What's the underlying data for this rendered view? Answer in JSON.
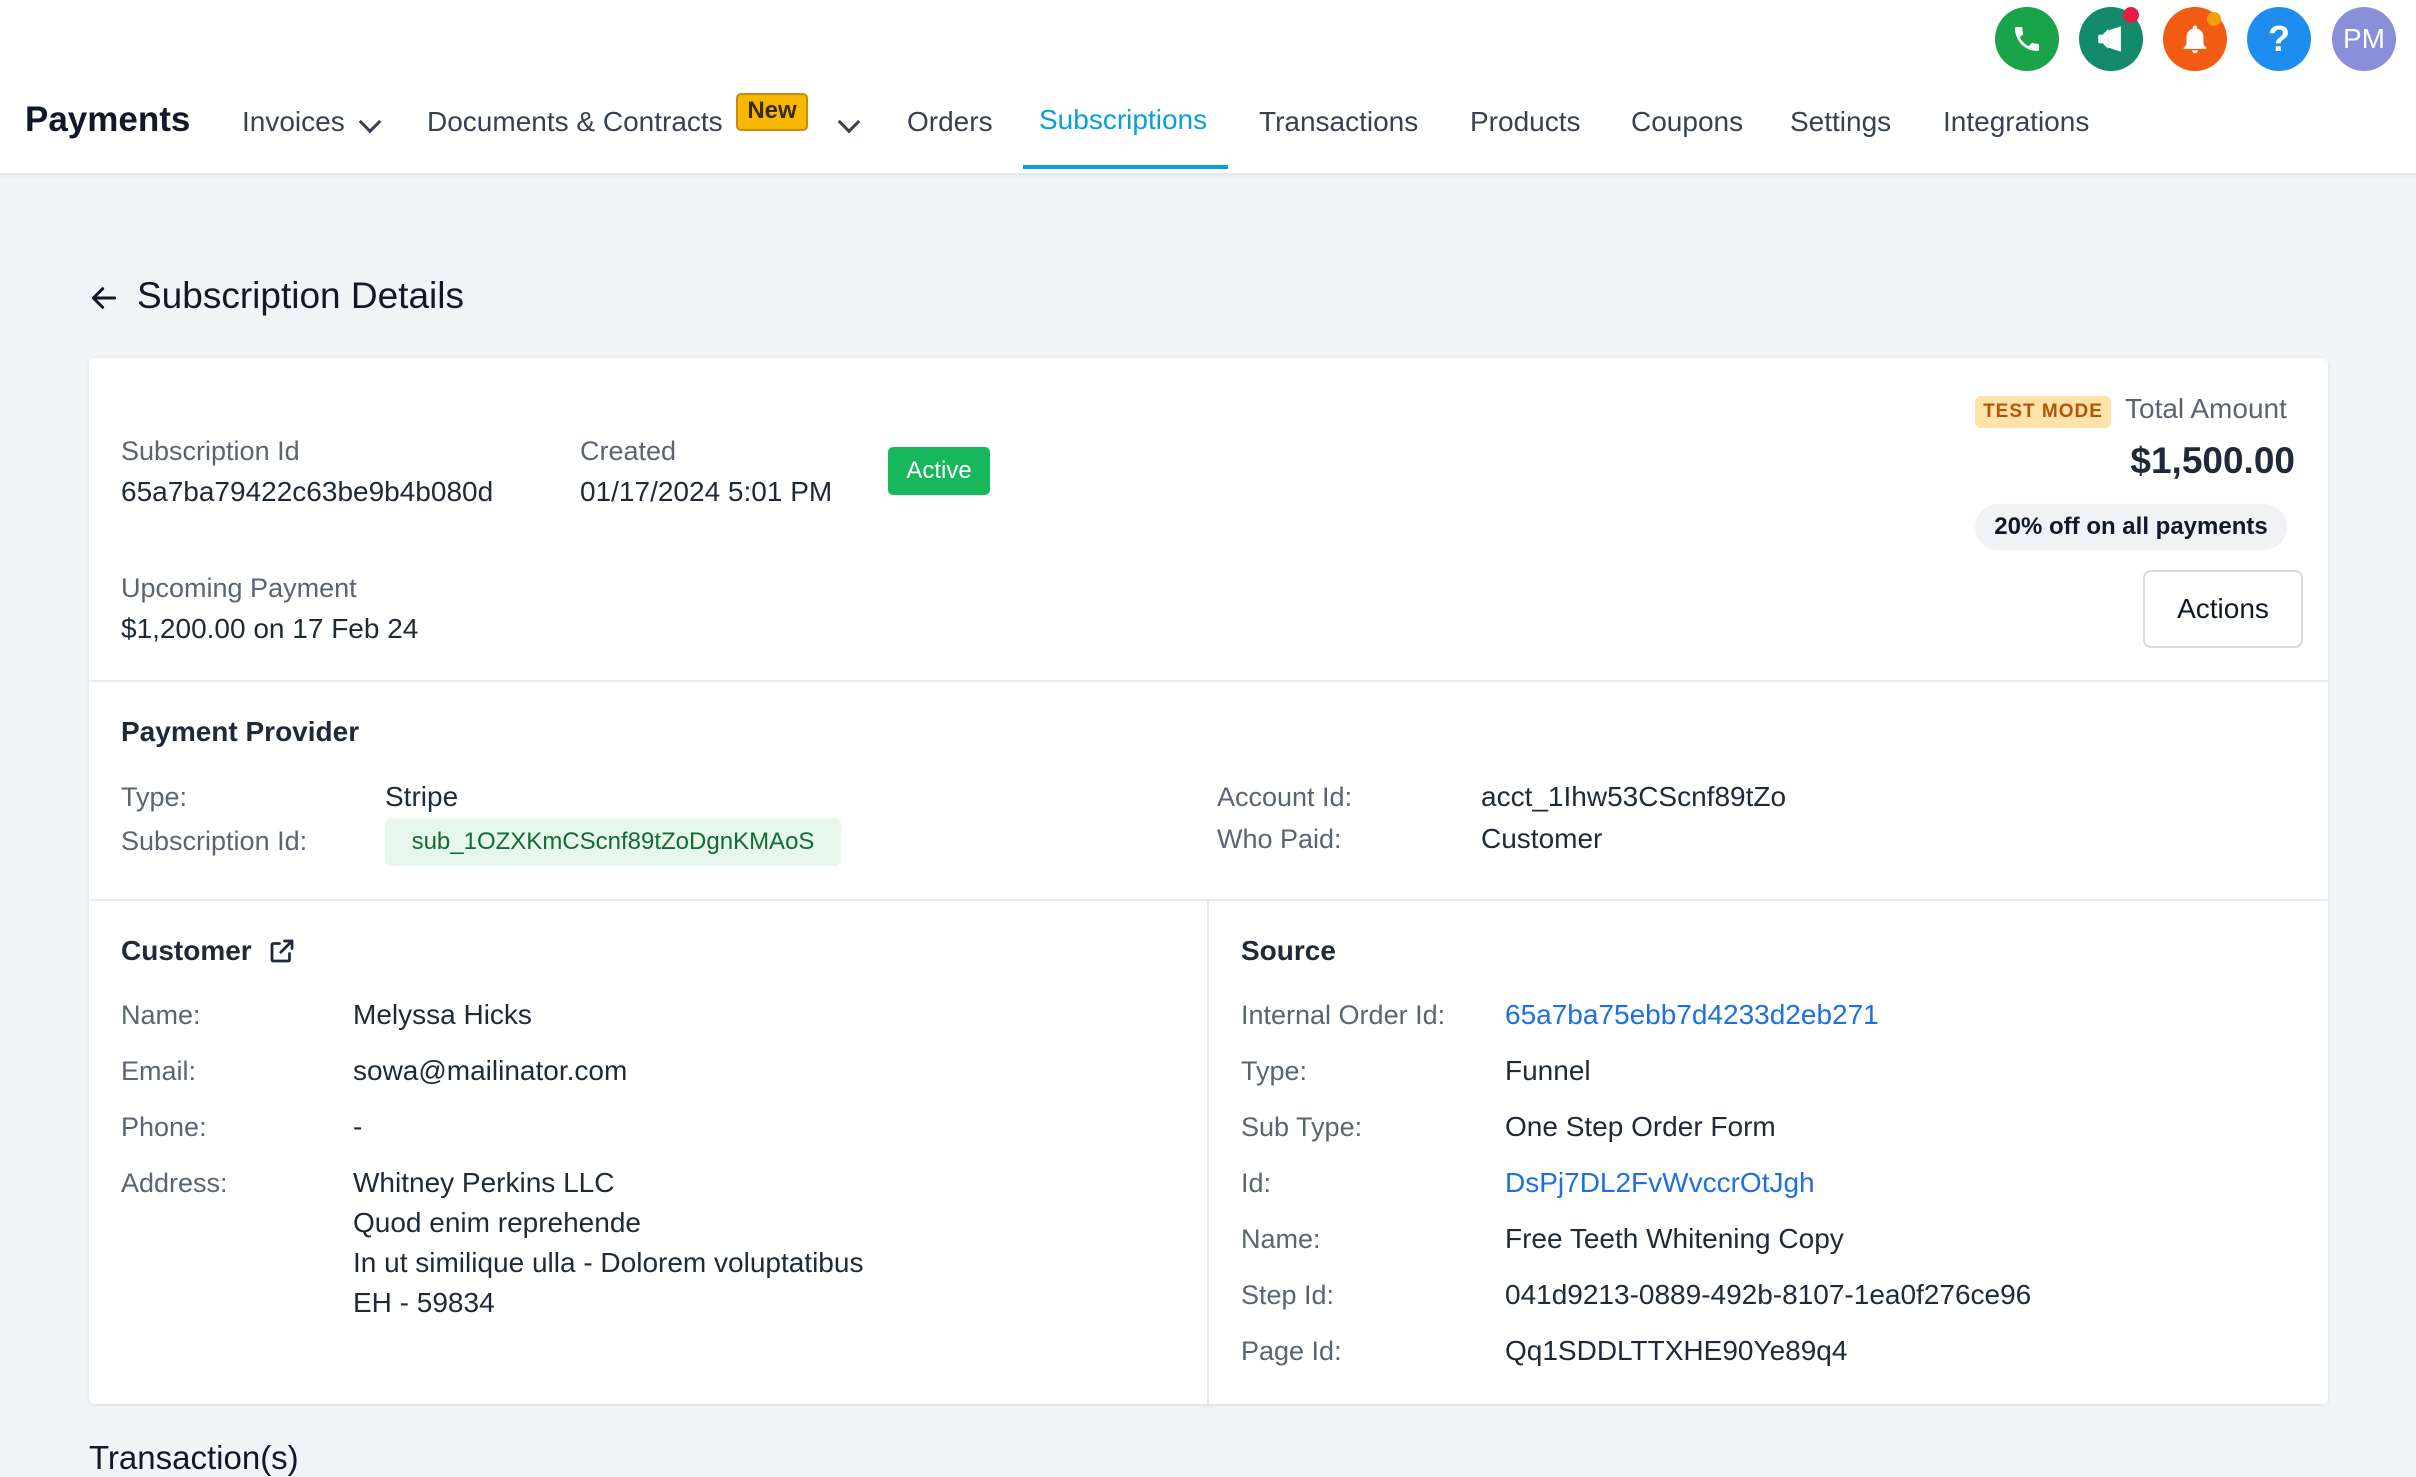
{
  "header": {
    "app_title": "Payments",
    "nav": [
      {
        "label": "Invoices",
        "has_dropdown": true
      },
      {
        "label": "Documents & Contracts",
        "badge": "New",
        "has_dropdown": true
      },
      {
        "label": "Orders"
      },
      {
        "label": "Subscriptions",
        "active": true
      },
      {
        "label": "Transactions"
      },
      {
        "label": "Products"
      },
      {
        "label": "Coupons"
      },
      {
        "label": "Settings"
      },
      {
        "label": "Integrations"
      }
    ],
    "top_buttons": [
      {
        "icon": "phone-icon",
        "color": "#1aa34a"
      },
      {
        "icon": "megaphone-icon",
        "color": "#138a6a",
        "notification_dot": "#e11d48"
      },
      {
        "icon": "bell-icon",
        "color": "#f25c12",
        "notification_dot": "#f59e0b"
      },
      {
        "icon": "help-icon",
        "color": "#1e8df0",
        "glyph": "?"
      }
    ],
    "avatar_initials": "PM"
  },
  "page": {
    "title": "Subscription Details"
  },
  "subscription": {
    "id_label": "Subscription Id",
    "id_value": "65a7ba79422c63be9b4b080d",
    "created_label": "Created",
    "created_value": "01/17/2024 5:01 PM",
    "status": "Active",
    "upcoming_label": "Upcoming Payment",
    "upcoming_value": "$1,200.00 on 17 Feb 24",
    "test_mode": "TEST MODE",
    "total_label": "Total Amount",
    "total_value": "$1,500.00",
    "discount": "20% off on all payments",
    "actions_label": "Actions"
  },
  "provider": {
    "title": "Payment Provider",
    "type_label": "Type:",
    "type_value": "Stripe",
    "sub_id_label": "Subscription Id:",
    "sub_id_value": "sub_1OZXKmCScnf89tZoDgnKMAoS",
    "account_label": "Account Id:",
    "account_value": "acct_1Ihw53CScnf89tZo",
    "who_paid_label": "Who Paid:",
    "who_paid_value": "Customer"
  },
  "customer": {
    "title": "Customer",
    "name_label": "Name:",
    "name_value": "Melyssa Hicks",
    "email_label": "Email:",
    "email_value": "sowa@mailinator.com",
    "phone_label": "Phone:",
    "phone_value": "-",
    "address_label": "Address:",
    "address_lines": [
      "Whitney Perkins LLC",
      "Quod enim reprehende",
      "In ut similique ulla - Dolorem voluptatibus",
      "EH - 59834"
    ]
  },
  "source": {
    "title": "Source",
    "order_label": "Internal Order Id:",
    "order_value": "65a7ba75ebb7d4233d2eb271",
    "type_label": "Type:",
    "type_value": "Funnel",
    "subtype_label": "Sub Type:",
    "subtype_value": "One Step Order Form",
    "id_label": "Id:",
    "id_value": "DsPj7DL2FvWvccrOtJgh",
    "name_label": "Name:",
    "name_value": "Free Teeth Whitening Copy",
    "step_label": "Step Id:",
    "step_value": "041d9213-0889-492b-8107-1ea0f276ce96",
    "page_label": "Page Id:",
    "page_value": "Qq1SDDLTTXHE90Ye89q4"
  },
  "transactions": {
    "heading": "Transaction(s)"
  }
}
